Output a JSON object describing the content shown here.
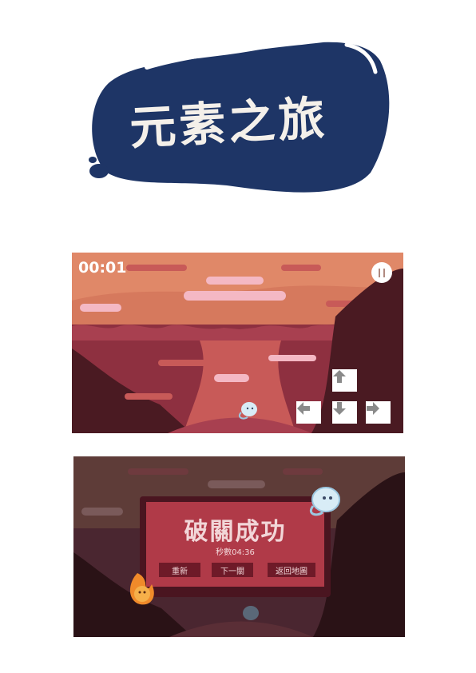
{
  "logo": {
    "title": "元素之旅"
  },
  "level": {
    "timer": "00:01",
    "controls": {
      "up": "up-arrow",
      "down": "down-arrow",
      "left": "left-arrow",
      "right": "right-arrow"
    }
  },
  "victory": {
    "title": "破關成功",
    "time": "秒數04:36",
    "buttons": {
      "restart": "重新",
      "next": "下一關",
      "map": "返回地圖"
    }
  },
  "colors": {
    "logo_blue": "#1e3566",
    "sky": "#e08868",
    "canyon": "#8e3040",
    "panel": "#b03a48",
    "panel_border": "#4a1520"
  }
}
